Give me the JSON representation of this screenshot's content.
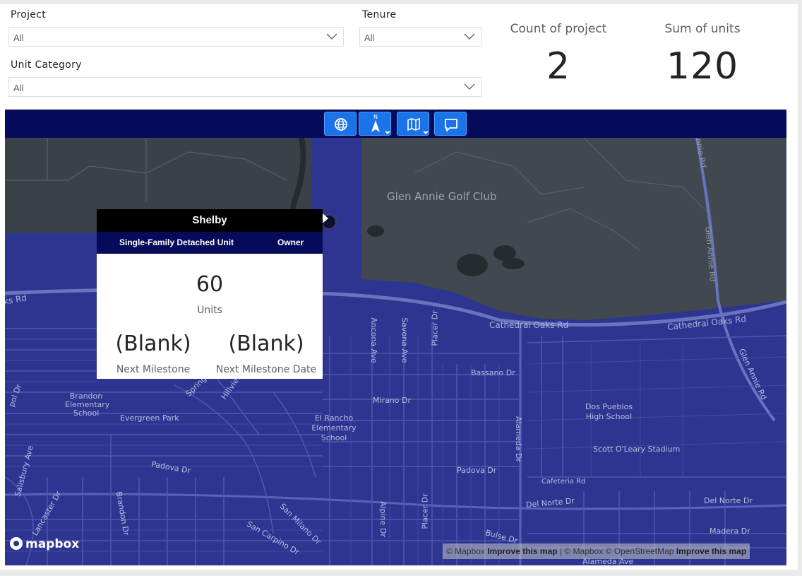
{
  "slicers": {
    "project": {
      "label": "Project",
      "value": "All"
    },
    "tenure": {
      "label": "Tenure",
      "value": "All"
    },
    "unit_category": {
      "label": "Unit Category",
      "value": "All"
    }
  },
  "cards": {
    "count_project": {
      "title": "Count of project",
      "value": "2"
    },
    "sum_units": {
      "title": "Sum of units",
      "value": "120"
    }
  },
  "map": {
    "toolbar": [
      "globe-icon",
      "north-arrow-icon",
      "map-style-icon",
      "comment-icon"
    ],
    "north_label": "N",
    "labels": {
      "golf": "Glen Annie Golf Club",
      "cathedral1": "Cathedral Oaks Rd",
      "cathedral2": "Cathedral Oaks Rd",
      "glen_annie_rd": "Glen Annie Rd",
      "glen_annie_rd2": "Glen Annie Rd",
      "nie_rd": "nnie Rd",
      "ks_rd": "ks Rd",
      "brandon_school": "Brandon Elementary School",
      "evergreen": "Evergreen Park",
      "el_rancho": "El Rancho Elementary School",
      "dos_pueblos": "Dos Pueblos High School",
      "scott": "Scott O'Leary Stadium",
      "bassano": "Bassano Dr",
      "mirano": "Mirano Dr",
      "padova1": "Padova Dr",
      "padova2": "Padova Dr",
      "cafeteria": "Cafeteria Rd",
      "delnorte1": "Del Norte Dr",
      "delnorte2": "Del Norte Dr",
      "madera": "Madera Dr",
      "alameda": "Alameda Ave",
      "alameda_dr": "Alameda Dr",
      "ancona": "Ancona Ave",
      "savona": "Savona Ave",
      "placer": "Placer Dr",
      "placer2": "Placer Dr",
      "alpine": "Alpine Dr",
      "brandon_dr": "Brandon Dr",
      "san_milano": "San Milano Dr",
      "san_carpino": "San Carpino Dr",
      "lancaster": "Lancaster Dr",
      "salisbury": "Salisbury Ave",
      "bulse": "Bulse Dr",
      "pol_dr": "pol Dr",
      "spring": "Spring",
      "hillview": "Hillview"
    },
    "popup": {
      "title": "Shelby",
      "category": "Single-Family Detached Unit",
      "tenure": "Owner",
      "units_value": "60",
      "units_label": "Units",
      "milestone_value": "(Blank)",
      "milestone_label": "Next Milestone",
      "milestone_date_value": "(Blank)",
      "milestone_date_label": "Next Milestone Date"
    },
    "logo": "mapbox",
    "attribution": {
      "a1": "© Mapbox",
      "improve1": "Improve this map",
      "a2": "| © Mapbox © OpenStreetMap",
      "improve2": "Improve this map"
    }
  },
  "colors": {
    "map_overlay": "#2e3590",
    "toolbar_bg": "#050a5a",
    "toolbar_button": "#1a73e8"
  }
}
